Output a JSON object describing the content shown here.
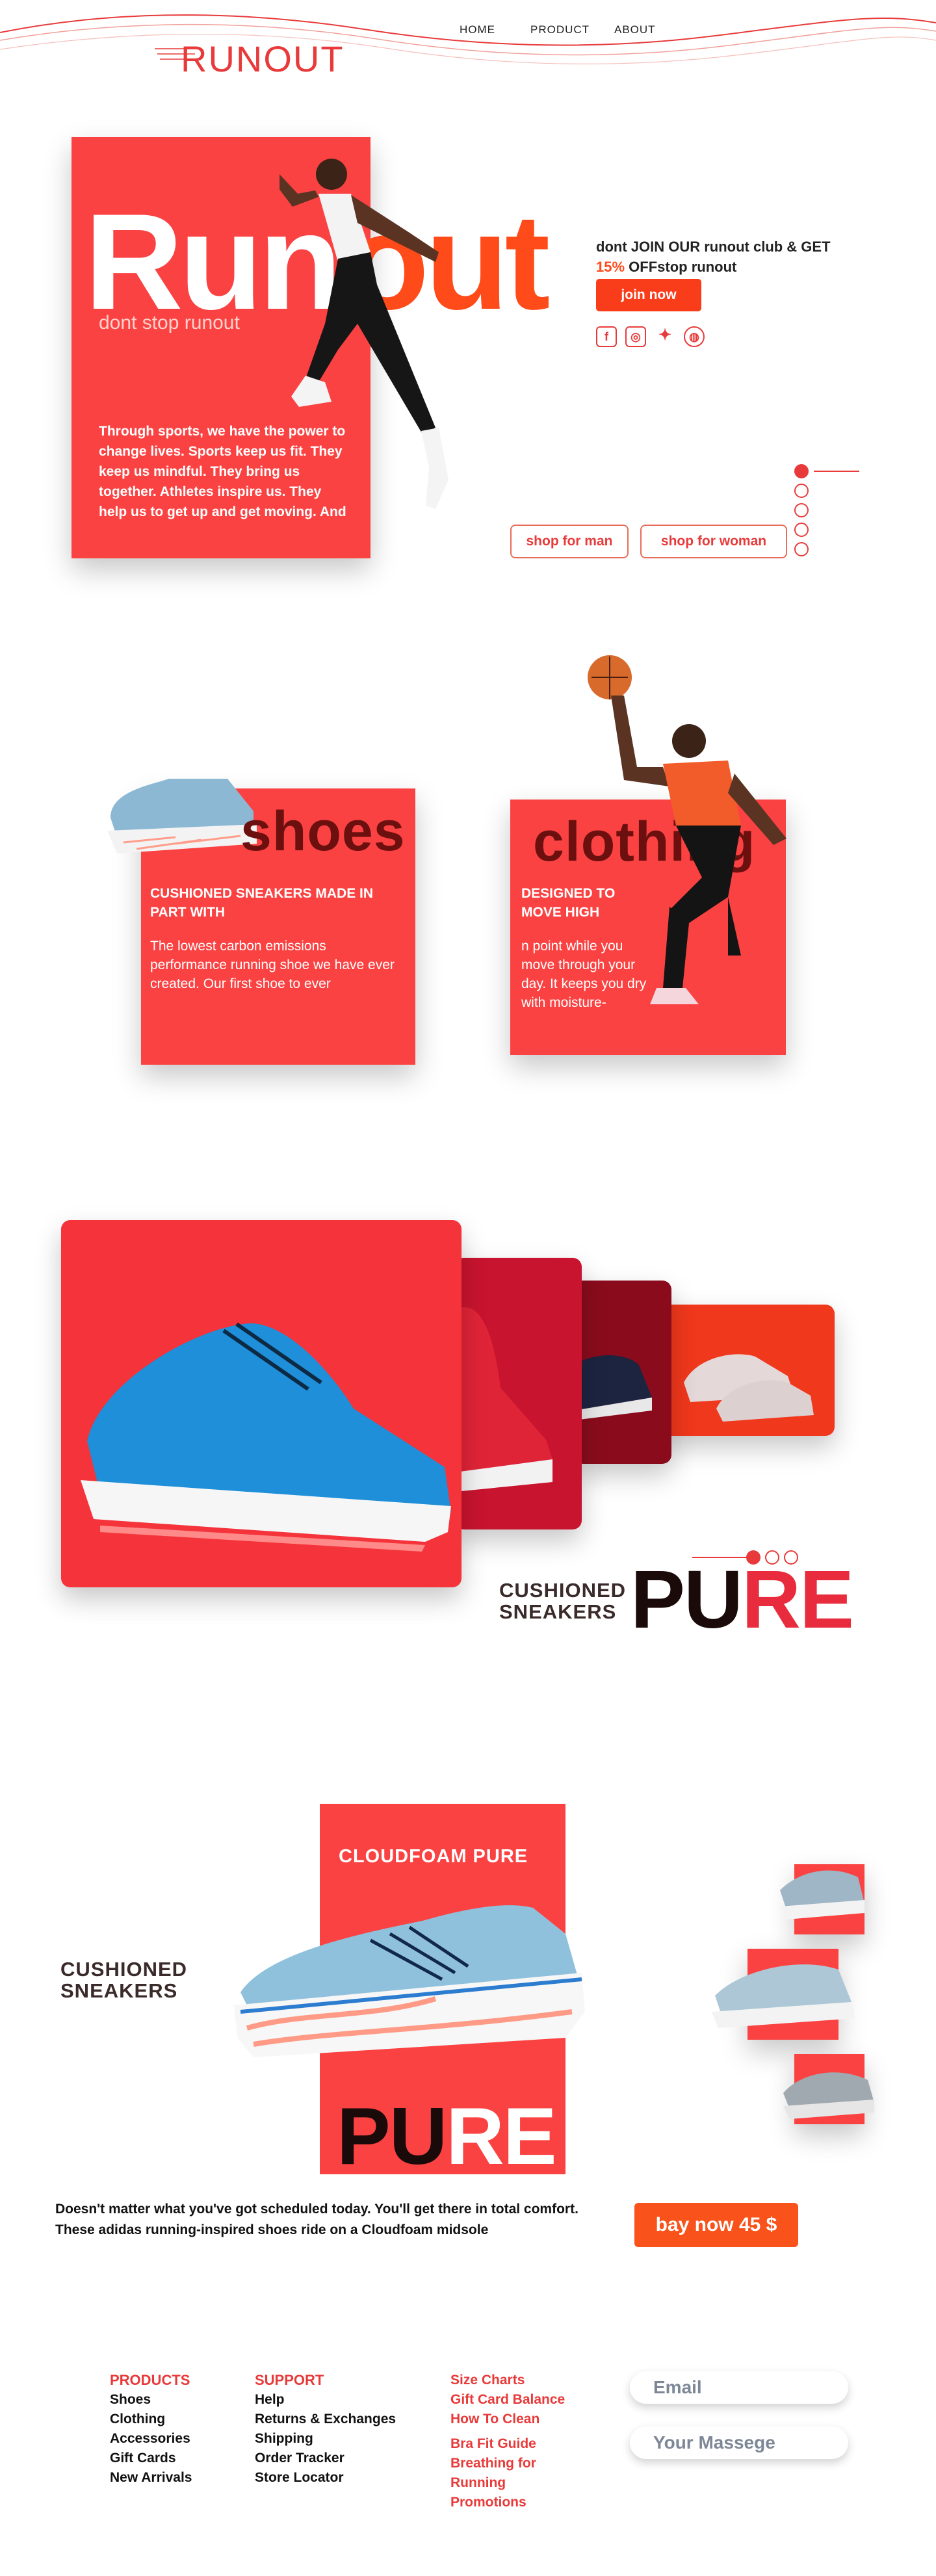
{
  "header": {
    "logo": "RUNOUT",
    "nav": [
      "HOME",
      "PRODUCT",
      "ABOUT"
    ]
  },
  "hero": {
    "big_left": "Run",
    "big_right": "out",
    "tagline": "dont stop runout",
    "text": "Through sports, we have the power to change lives. Sports keep us fit. They keep us mindful. They bring us together. Athletes inspire us. They help us to get up and get moving. And",
    "club_line1": "dont JOIN OUR runout club & GET",
    "club_pct": "15%",
    "club_line2": " OFFstop runout",
    "join_label": "join now",
    "social": [
      "f",
      "ig",
      "tw",
      "dr"
    ],
    "shop_man": "shop for man",
    "shop_woman": "shop for woman"
  },
  "categories": {
    "shoes": {
      "title": "shoes",
      "sub": "CUSHIONED SNEAKERS MADE IN PART WITH",
      "body": "The lowest carbon emissions performance running shoe we have ever created. Our first shoe to ever"
    },
    "clothing": {
      "title": "clothing",
      "sub": "DESIGNED TO MOVE HIGH",
      "body": "n point while you move through your day. It keeps you dry with moisture-"
    }
  },
  "gallery": {
    "label": "CUSHIONED SNEAKERS",
    "pure_dark": "PU",
    "pure_red": "RE"
  },
  "product": {
    "label": "CUSHIONED SNEAKERS",
    "title": "CLOUDFOAM PURE",
    "pure_dark": "PU",
    "pure_red": "RE",
    "description": "Doesn't matter what you've got scheduled today. You'll get there in total comfort. These adidas running-inspired shoes ride on a Cloudfoam midsole",
    "buy_label": "bay now 45 $"
  },
  "footer": {
    "products_head": "PRODUCTS",
    "products": [
      "Shoes",
      "Clothing",
      "Accessories",
      "Gift Cards",
      "New Arrivals"
    ],
    "support_head": "SUPPORT",
    "support": [
      "Help",
      "Returns & Exchanges",
      "Shipping",
      "Order Tracker",
      "Store Locator"
    ],
    "links": [
      "Size Charts",
      "Gift Card Balance",
      "How To Clean",
      "Bra Fit Guide",
      "Breathing for",
      "Running",
      "Promotions"
    ],
    "email_placeholder": "Email",
    "message_placeholder": "Your Massege"
  },
  "colors": {
    "brand_red": "#fb4242",
    "accent_orange": "#ff4a1a",
    "shoe_blue": "#1e8fd8"
  }
}
